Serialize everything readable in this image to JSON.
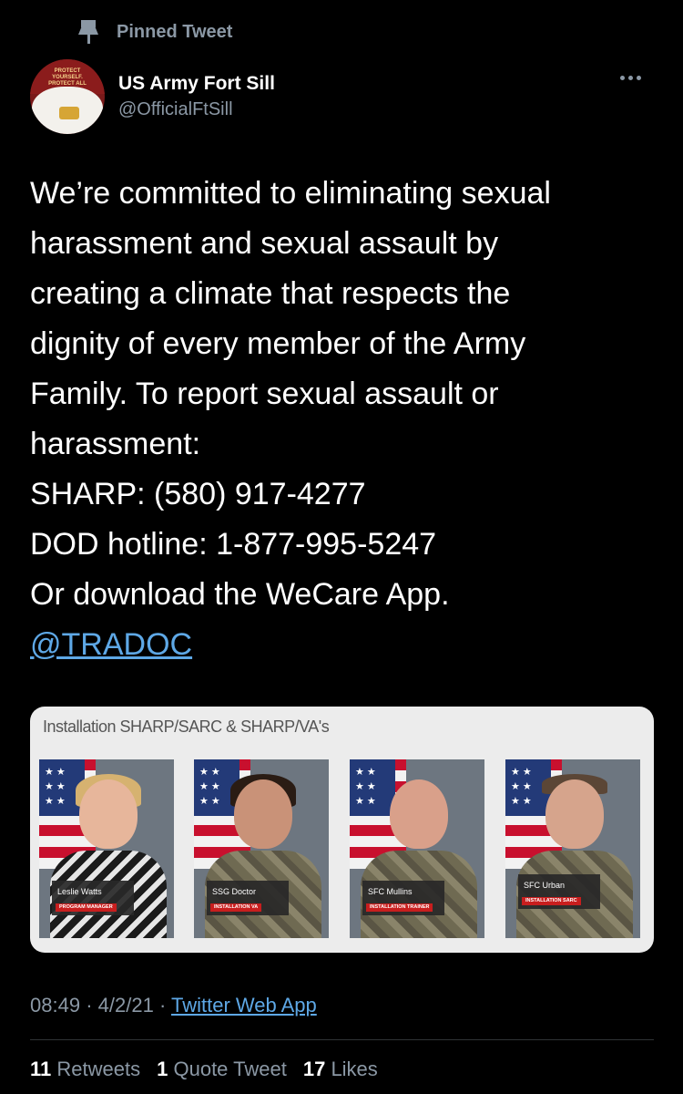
{
  "pinned_label": "Pinned Tweet",
  "author": {
    "name": "US Army Fort Sill",
    "handle": "@OfficialFtSill",
    "avatar_text": "PROTECT YOURSELF. PROTECT ALL OTHERS"
  },
  "tweet": {
    "lines": [
      "We’re committed to eliminating sexual",
      "harassment and sexual assault by",
      "creating a climate that respects the",
      "dignity of every member of the Army",
      "Family. To report sexual assault or",
      "harassment:",
      "SHARP: (580) 917-4277",
      "DOD hotline: 1-877-995-5247",
      "Or download the WeCare App."
    ],
    "mention": "@TRADOC"
  },
  "media": {
    "title": "Installation SHARP/SARC & SHARP/VA's",
    "cards": [
      {
        "name": "Leslie Watts",
        "role": "PROGRAM MANAGER"
      },
      {
        "name": "SSG Doctor",
        "role": "INSTALLATION VA"
      },
      {
        "name": "SFC Mullins",
        "role": "INSTALLATION TRAINER"
      },
      {
        "name": "SFC Urban",
        "role": "INSTALLATION SARC"
      }
    ]
  },
  "meta": {
    "time": "08:49",
    "date": "4/2/21",
    "separator": "·",
    "app": "Twitter Web App"
  },
  "stats": {
    "retweets_count": "11",
    "retweets_label": "Retweets",
    "quotes_count": "1",
    "quotes_label": "Quote Tweet",
    "likes_count": "17",
    "likes_label": "Likes"
  },
  "colors": {
    "background": "#000000",
    "link": "#5ea8e6",
    "muted": "#8b98a5"
  },
  "icons": [
    "pin-icon",
    "more-icon"
  ]
}
